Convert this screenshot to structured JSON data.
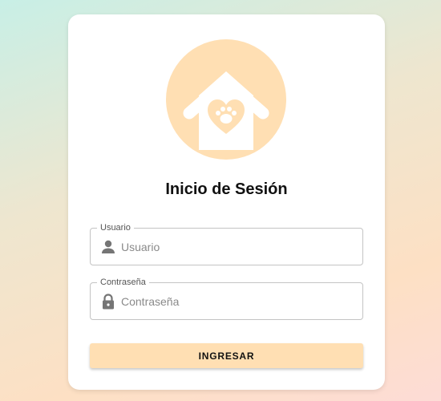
{
  "colors": {
    "logo_circle": "#ffdfb3",
    "button_bg": "#ffdfb3",
    "card_bg": "#ffffff"
  },
  "logo": {
    "icon": "dog-house-paw-heart-icon"
  },
  "login": {
    "title": "Inicio de Sesión",
    "username": {
      "label": "Usuario",
      "placeholder": "Usuario",
      "value": "",
      "icon": "person-icon"
    },
    "password": {
      "label": "Contraseña",
      "placeholder": "Contraseña",
      "value": "",
      "icon": "lock-icon"
    },
    "submit_label": "INGRESAR"
  }
}
